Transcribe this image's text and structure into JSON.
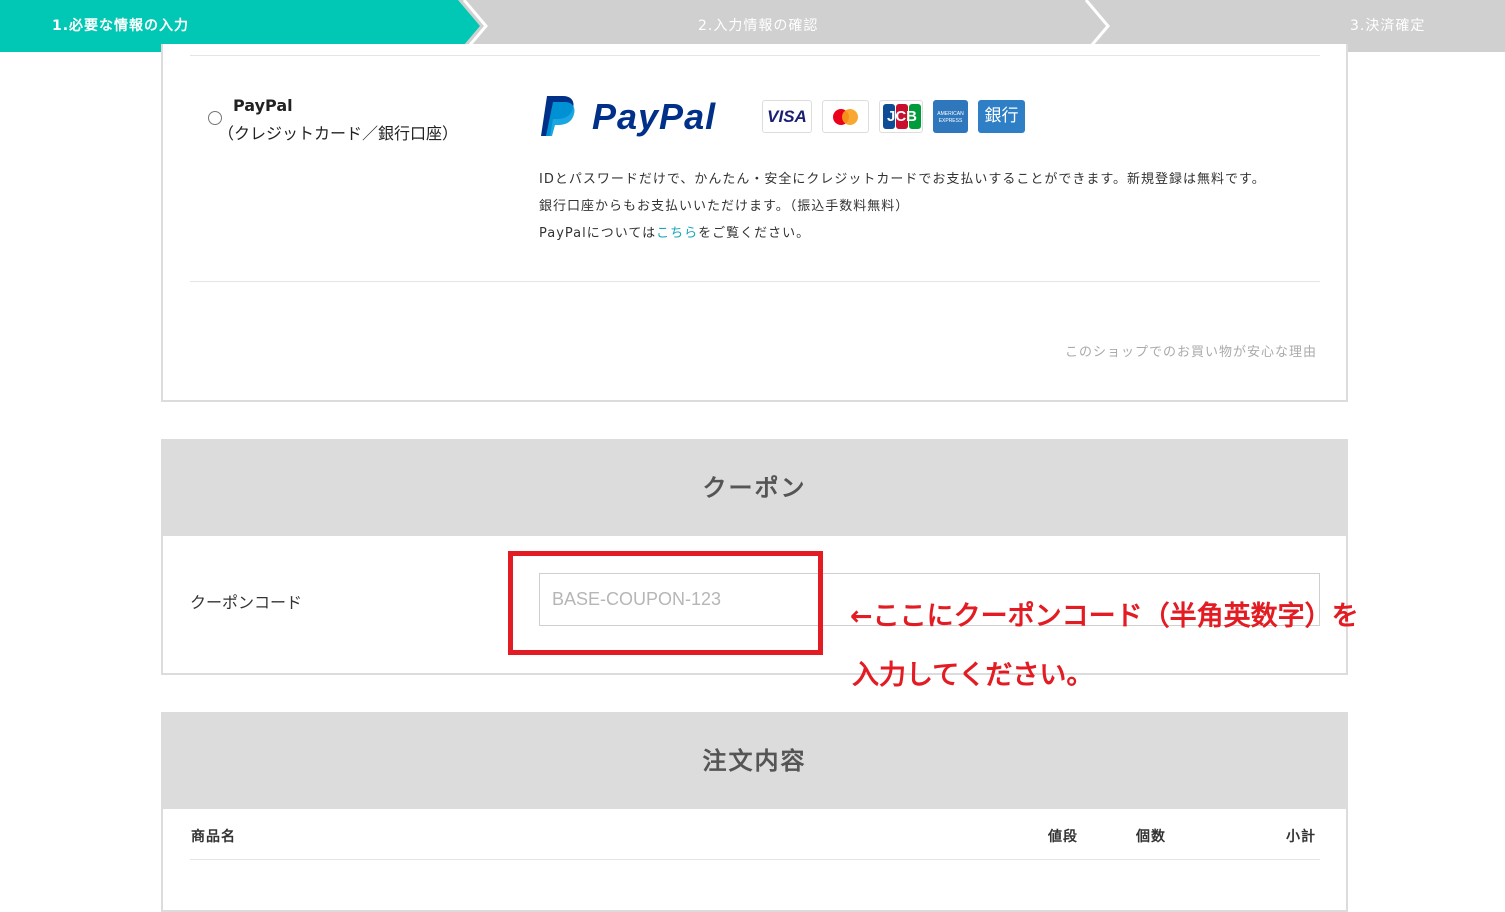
{
  "colors": {
    "accent": "#00c8b4",
    "step_gray": "#d0d0d0",
    "annotation_red": "#e31b23",
    "link": "#16a5b8"
  },
  "steps": [
    {
      "label": "1.必要な情報の入力",
      "active": true
    },
    {
      "label": "2.入力情報の確認",
      "active": false
    },
    {
      "label": "3.決済確定",
      "active": false
    }
  ],
  "paypal": {
    "name": "PayPal",
    "subtitle": "（クレジットカード／銀行口座）",
    "logo_text": "PayPal",
    "logo_icon": "paypal-p-logo-icon",
    "cards": [
      {
        "label": "VISA",
        "icon": "visa-card-icon"
      },
      {
        "label": "",
        "icon": "mastercard-icon"
      },
      {
        "label": "JCB",
        "icon": "jcb-card-icon"
      },
      {
        "label": "AMERICAN EXPRESS",
        "icon": "amex-card-icon"
      },
      {
        "label": "銀行",
        "icon": "bank-icon"
      }
    ],
    "desc_line1": "IDとパスワードだけで、かんたん・安全にクレジットカードでお支払いすることができます。新規登録は無料です。",
    "desc_line2": "銀行口座からもお支払いいただけます。（振込手数料無料）",
    "desc_line3_pre": "PayPalについては",
    "desc_line3_link": "こちら",
    "desc_line3_post": "をご覧ください。",
    "safe_reason_link": "このショップでのお買い物が安心な理由"
  },
  "coupon": {
    "title": "クーポン",
    "label": "クーポンコード",
    "placeholder": "BASE-COUPON-123",
    "value": "",
    "annotation_line1": "←ここにクーポンコード（半角英数字）を",
    "annotation_line2": "入力してください。"
  },
  "order": {
    "title": "注文内容",
    "headers": [
      "商品名",
      "値段",
      "個数",
      "小計"
    ]
  }
}
